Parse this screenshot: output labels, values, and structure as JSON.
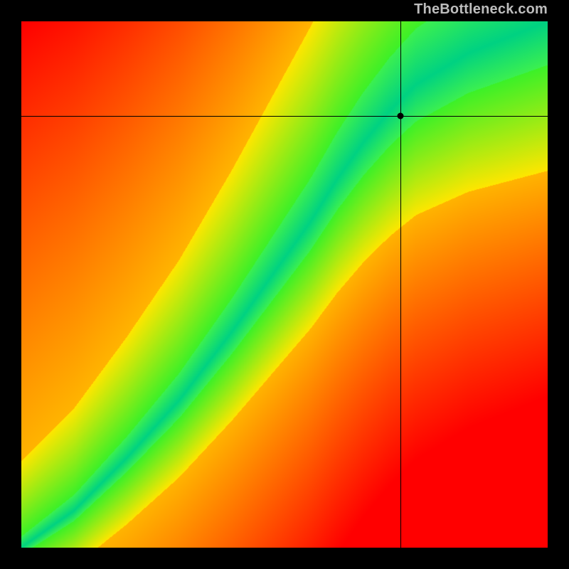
{
  "attribution": "TheBottleneck.com",
  "chart_data": {
    "type": "heatmap",
    "title": "",
    "xlabel": "",
    "ylabel": "",
    "xlim": [
      0,
      100
    ],
    "ylim": [
      0,
      100
    ],
    "colormap": "red-yellow-green-yellow-red",
    "description": "2D bottleneck compatibility heatmap. Green ridge along an S-shaped curve indicates optimal pairing; red regions indicate severe mismatch.",
    "ridge_curve": [
      {
        "x": 0,
        "y": 0
      },
      {
        "x": 10,
        "y": 7
      },
      {
        "x": 20,
        "y": 17
      },
      {
        "x": 30,
        "y": 28
      },
      {
        "x": 40,
        "y": 41
      },
      {
        "x": 50,
        "y": 55
      },
      {
        "x": 55,
        "y": 62
      },
      {
        "x": 60,
        "y": 70
      },
      {
        "x": 65,
        "y": 77
      },
      {
        "x": 70,
        "y": 83
      },
      {
        "x": 75,
        "y": 88
      },
      {
        "x": 85,
        "y": 94
      },
      {
        "x": 100,
        "y": 100
      }
    ],
    "marker": {
      "x": 72,
      "y": 82
    },
    "crosshair": {
      "x": 72,
      "y": 82
    }
  },
  "layout": {
    "plot_left": 30,
    "plot_top": 30,
    "plot_size": 740
  }
}
